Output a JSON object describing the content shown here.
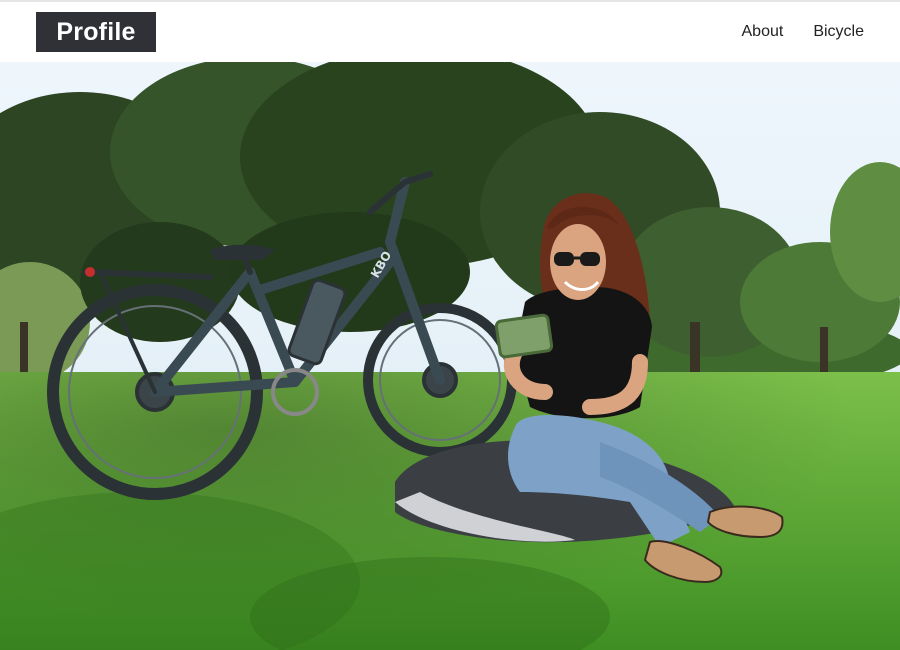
{
  "header": {
    "brand": "Profile",
    "nav": [
      {
        "label": "About"
      },
      {
        "label": "Bicycle"
      }
    ]
  },
  "hero": {
    "image_description": "Woman in sunglasses sitting on a blanket in a grassy park, holding a green tablet, next to a dark gray electric bicycle.",
    "bike_logo": "KBO",
    "colors": {
      "sky": "#eaf3fb",
      "trees": "#2f4a25",
      "grass": "#5aa02c",
      "bike": "#3a4a52"
    }
  }
}
